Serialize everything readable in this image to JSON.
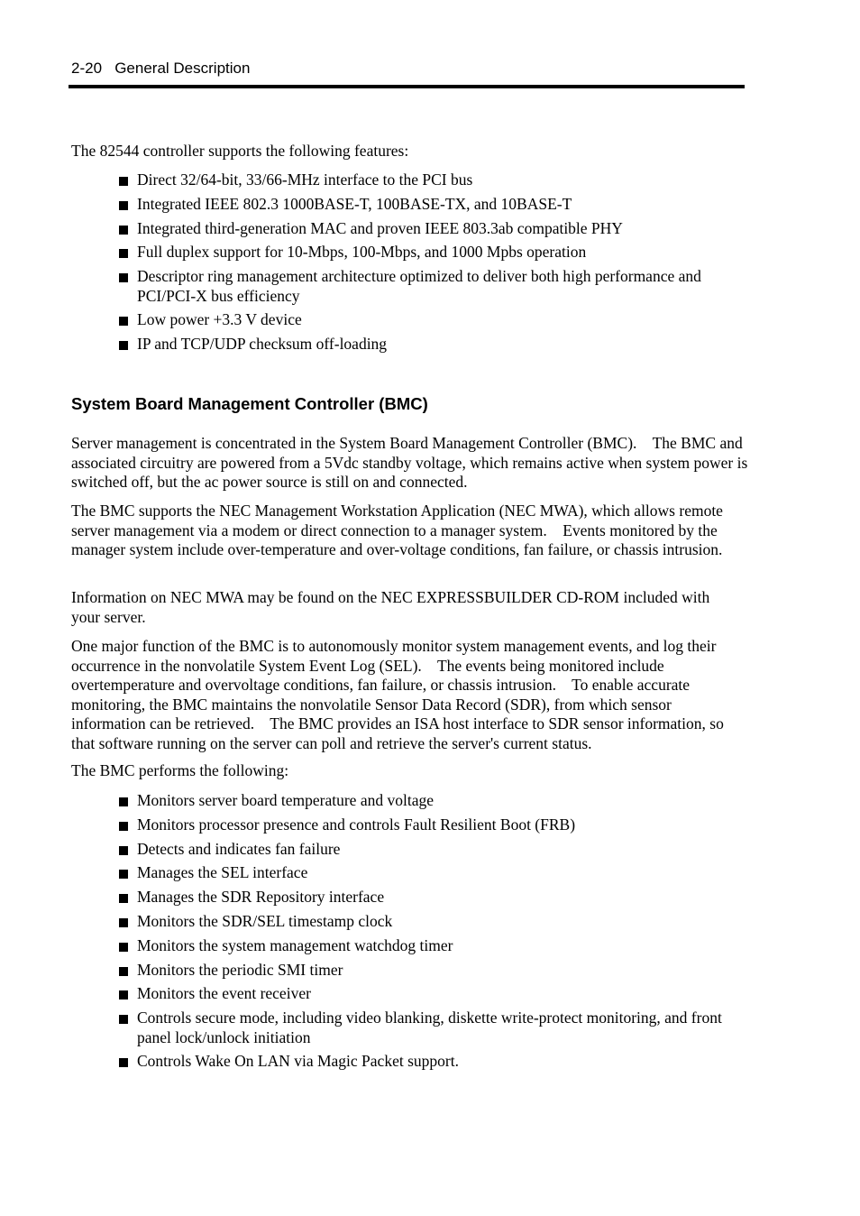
{
  "header": {
    "page_number": "2-20",
    "section_title": "General Description"
  },
  "intro": "The 82544 controller supports the following features:",
  "features": [
    "Direct 32/64-bit, 33/66-MHz interface to the PCI bus",
    "Integrated IEEE 802.3 1000BASE-T, 100BASE-TX, and 10BASE-T",
    "Integrated third-generation MAC and proven IEEE 803.3ab compatible PHY",
    "Full duplex support for 10-Mbps, 100-Mbps, and 1000 Mpbs operation",
    "Descriptor ring management architecture optimized to deliver both high performance and PCI/PCI-X bus efficiency",
    "Low power +3.3 V device",
    "IP and TCP/UDP checksum off-loading"
  ],
  "bmc": {
    "heading": "System Board Management Controller (BMC)",
    "paragraphs": [
      "Server management is concentrated in the System Board Management Controller (BMC).    The BMC and associated circuitry are powered from a 5Vdc standby voltage, which remains active when system power is switched off, but the ac power source is still on and connected.",
      "The BMC supports the NEC Management Workstation Application (NEC MWA), which allows remote server management via a modem or direct connection to a manager system.    Events monitored by the manager system include over-temperature and over-voltage conditions, fan failure, or chassis intrusion.",
      "Information on NEC MWA may be found on the NEC EXPRESSBUILDER CD-ROM included with your server.",
      "One major function of the BMC is to autonomously monitor system management events, and log their occurrence in the nonvolatile System Event Log (SEL).    The events being monitored include overtemperature and overvoltage conditions, fan failure, or chassis intrusion.    To enable accurate monitoring, the BMC maintains the nonvolatile Sensor Data Record (SDR), from which sensor information can be retrieved.    The BMC provides an ISA host interface to SDR sensor information, so that software running on the server can poll and retrieve the server's current status.",
      "The BMC performs the following:"
    ],
    "functions": [
      "Monitors server board temperature and voltage",
      "Monitors processor presence and controls Fault Resilient Boot (FRB)",
      "Detects and indicates fan failure",
      "Manages the SEL interface",
      "Manages the SDR Repository interface",
      "Monitors the SDR/SEL timestamp clock",
      "Monitors the system management watchdog timer",
      "Monitors the periodic SMI timer",
      "Monitors the event receiver",
      "Controls secure mode, including video blanking, diskette write-protect monitoring, and front panel lock/unlock initiation",
      "Controls Wake On LAN via Magic Packet support."
    ]
  }
}
